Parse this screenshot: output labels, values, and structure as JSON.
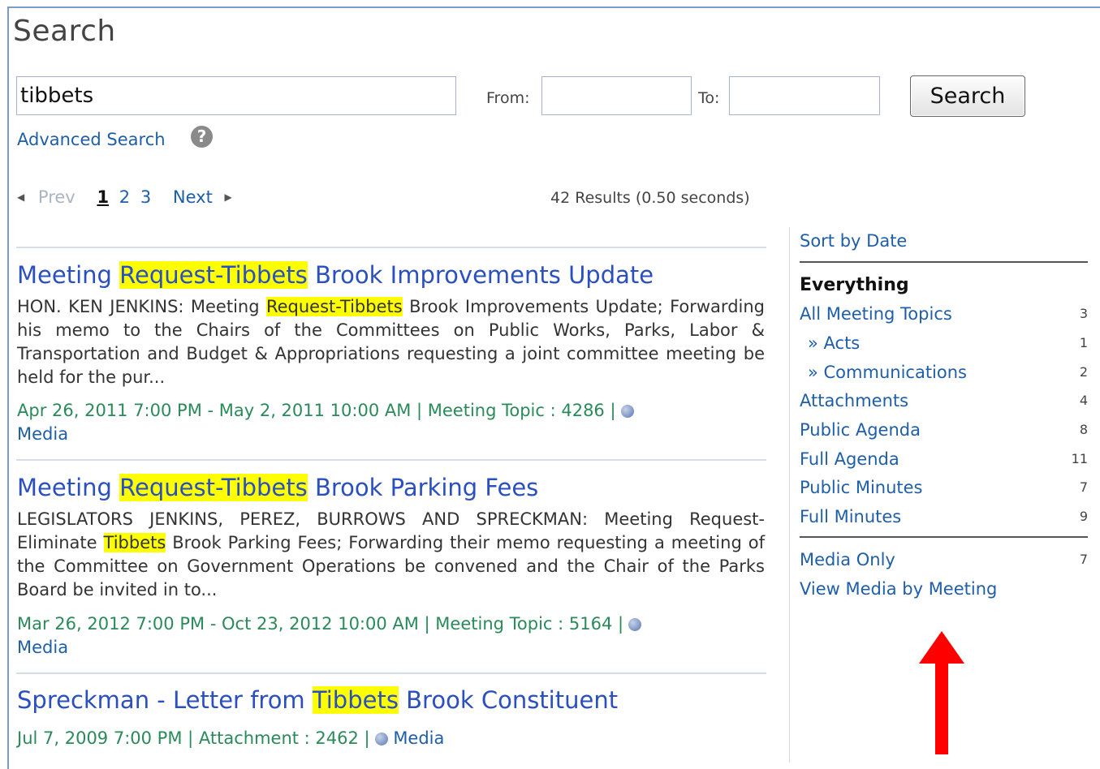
{
  "page": {
    "title": "Search"
  },
  "search": {
    "query": "tibbets",
    "from_label": "From:",
    "from_value": "",
    "to_label": "To:",
    "to_value": "",
    "button_label": "Search",
    "advanced_label": "Advanced Search",
    "help_glyph": "?"
  },
  "pagination": {
    "prev_label": "Prev",
    "pages": [
      "1",
      "2",
      "3"
    ],
    "current_page": "1",
    "next_label": "Next",
    "summary": "42 Results (0.50 seconds)"
  },
  "results": [
    {
      "title_pre": "Meeting ",
      "title_hl": "Request-Tibbets",
      "title_post": " Brook Improvements Update",
      "snippet_pre": "HON. KEN JENKINS: Meeting ",
      "snippet_hl": "Request-Tibbets",
      "snippet_post": " Brook Improvements Update; Forwarding his memo to the Chairs of the Committees on Public Works, Parks, Labor & Transportation and Budget & Appropriations requesting a joint committee meeting be held for the pur...",
      "meta": "Apr 26, 2011 7:00 PM - May 2, 2011 10:00 AM | Meeting Topic : 4286 |",
      "media_label": "Media"
    },
    {
      "title_pre": "Meeting ",
      "title_hl": "Request-Tibbets",
      "title_post": " Brook Parking Fees",
      "snippet_pre": "LEGISLATORS JENKINS, PEREZ, BURROWS AND SPRECKMAN: Meeting Request-Eliminate ",
      "snippet_hl": "Tibbets",
      "snippet_post": " Brook Parking Fees; Forwarding their memo requesting a meeting of the Committee on Government Operations be convened and the Chair of the Parks Board be invited in to...",
      "meta": "Mar 26, 2012 7:00 PM - Oct 23, 2012 10:00 AM | Meeting Topic : 5164 |",
      "media_label": "Media"
    },
    {
      "title_pre": "Spreckman - Letter from ",
      "title_hl": "Tibbets",
      "title_post": " Brook Constituent",
      "meta": "Jul 7, 2009 7:00 PM | Attachment : 2462 |",
      "media_label": "Media"
    }
  ],
  "sidebar": {
    "sort_label": "Sort by Date",
    "heading": "Everything",
    "filters": [
      {
        "label": "All Meeting Topics",
        "count": "3"
      },
      {
        "label": "» Acts",
        "count": "1"
      },
      {
        "label": "» Communications",
        "count": "2"
      },
      {
        "label": "Attachments",
        "count": "4"
      },
      {
        "label": "Public Agenda",
        "count": "8"
      },
      {
        "label": "Full Agenda",
        "count": "11"
      },
      {
        "label": "Public Minutes",
        "count": "7"
      },
      {
        "label": "Full Minutes",
        "count": "9"
      }
    ],
    "media_only": {
      "label": "Media Only",
      "count": "7"
    },
    "view_media_label": "View Media by Meeting"
  },
  "annotation": {
    "arrow_color": "#ff0000"
  }
}
